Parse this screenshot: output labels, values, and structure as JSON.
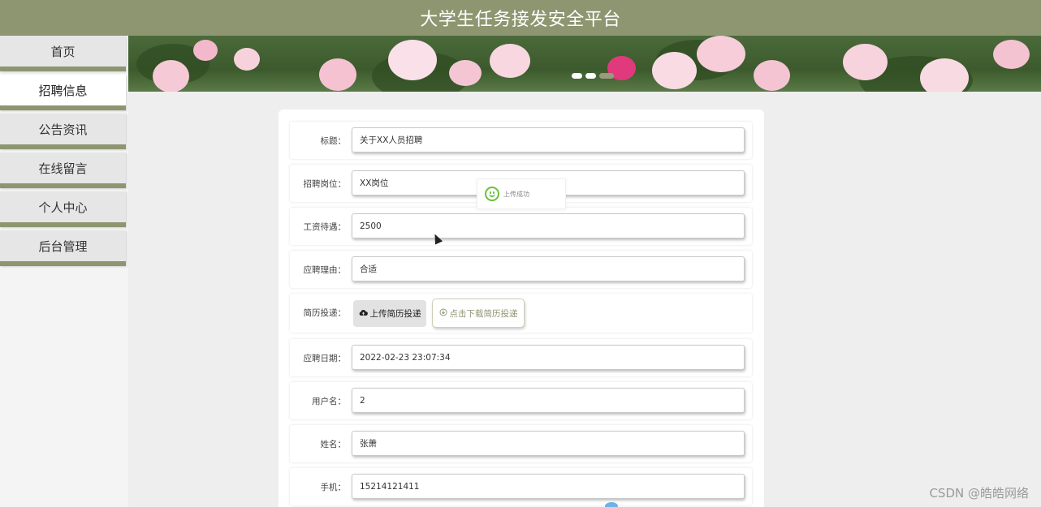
{
  "header": {
    "title": "大学生任务接发安全平台"
  },
  "sidebar": {
    "items": [
      {
        "label": "首页",
        "active": false
      },
      {
        "label": "招聘信息",
        "active": true
      },
      {
        "label": "公告资讯",
        "active": false
      },
      {
        "label": "在线留言",
        "active": false
      },
      {
        "label": "个人中心",
        "active": false
      },
      {
        "label": "后台管理",
        "active": false
      }
    ]
  },
  "form": {
    "title_label": "标题：",
    "title_value": "关于XX人员招聘",
    "position_label": "招聘岗位：",
    "position_value": "XX岗位",
    "salary_label": "工资待遇：",
    "salary_value": "2500",
    "reason_label": "应聘理由：",
    "reason_value": "合适",
    "resume_label": "简历投递：",
    "upload_button": "上传简历投递",
    "download_button": "点击下载简历投递",
    "date_label": "应聘日期：",
    "date_value": "2022-02-23 23:07:34",
    "username_label": "用户名：",
    "username_value": "2",
    "name_label": "姓名：",
    "name_value": "张萧",
    "phone_label": "手机：",
    "phone_value": "15214121411"
  },
  "toast": {
    "message": "上传成功"
  },
  "watermark": "CSDN @皓皓网络",
  "colors": {
    "accent": "#8d9670",
    "success": "#67c23a"
  }
}
